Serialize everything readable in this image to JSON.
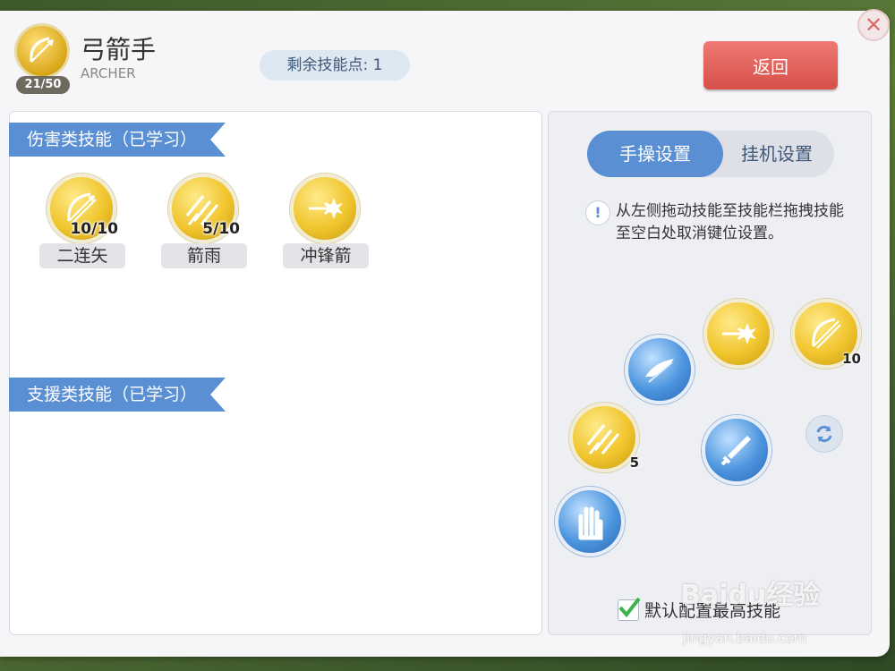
{
  "window": {
    "close_glyph": "✕"
  },
  "header": {
    "job_name": "弓箭手",
    "job_name_en": "ARCHER",
    "job_level": "21/50",
    "skill_points": "剩余技能点: 1",
    "back_label": "返回"
  },
  "left": {
    "damage_section": "伤害类技能（已学习）",
    "support_section": "支援类技能（已学习）",
    "damage_skills": [
      {
        "name": "二连矢",
        "level": "10/10",
        "icon": "bow-icon"
      },
      {
        "name": "箭雨",
        "level": "5/10",
        "icon": "arrow-rain-icon"
      },
      {
        "name": "冲锋箭",
        "level": "",
        "icon": "charge-arrow-icon"
      }
    ]
  },
  "right": {
    "tabs": [
      "手操设置",
      "挂机设置"
    ],
    "active_tab": 0,
    "hint": "从左侧拖动技能至技能栏拖拽技能至空白处取消键位设置。",
    "slots": [
      {
        "icon": "charge-arrow-icon",
        "badge": ""
      },
      {
        "icon": "bow-icon",
        "badge": "10"
      },
      {
        "icon": "feather-dash-icon",
        "badge": ""
      },
      {
        "icon": "arrow-rain-icon",
        "badge": "5"
      },
      {
        "icon": "sword-icon",
        "badge": ""
      },
      {
        "icon": "hand-icon",
        "badge": ""
      }
    ],
    "checkbox_label": "默认配置最高技能",
    "checked": true
  },
  "watermark": {
    "text": "Baidu经验",
    "url": "jingyan.baidu.com"
  },
  "colors": {
    "accent": "#5b8fd4",
    "back_button": "#e0605a",
    "gold": "#f0c52d"
  }
}
